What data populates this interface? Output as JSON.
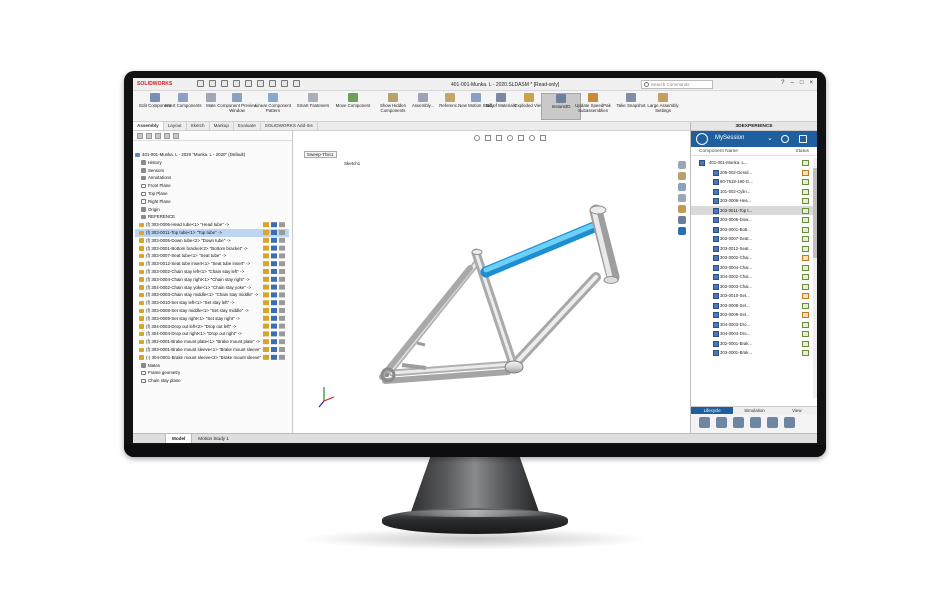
{
  "app": {
    "logo": "SOLIDWORKS",
    "document_title": "401-001-Munka. L - 2020.SLDASM * [Read-only]",
    "search_placeholder": "Search Commands"
  },
  "commands": [
    {
      "label": "Edit Component",
      "color": "#7b8fb0"
    },
    {
      "label": "Insert Components",
      "color": "#8aa0c4"
    },
    {
      "label": "Mate",
      "color": "#a0a8b8"
    },
    {
      "label": "Component Preview Window",
      "color": "#8da2c2"
    },
    {
      "label": "Linear Component Pattern",
      "color": "#8aa7cf"
    },
    {
      "label": "Smart Fasteners",
      "color": "#a8b0bc"
    },
    {
      "label": "Move Component",
      "color": "#6f9e5a"
    },
    {
      "label": "Show Hidden Components",
      "color": "#b7a36a"
    },
    {
      "label": "Assembly...",
      "color": "#9aa4b6"
    },
    {
      "label": "Referenc...",
      "color": "#c6a46a"
    },
    {
      "label": "New Motion Study",
      "color": "#8a9fc1"
    },
    {
      "label": "Bill of Materials",
      "color": "#7a8aa5"
    },
    {
      "label": "Exploded View",
      "color": "#c9a44a"
    },
    {
      "label": "Instant3D",
      "color": "#6d7f9c"
    },
    {
      "label": "Update SpeedPak Subassemblies",
      "color": "#c98a3a"
    },
    {
      "label": "Take Snapshot",
      "color": "#7f8fa8"
    },
    {
      "label": "Large Assembly Settings",
      "color": "#c2a063"
    }
  ],
  "tabs": [
    "Assembly",
    "Layout",
    "Sketch",
    "Markup",
    "Evaluate",
    "SOLIDWORKS Add-Ins"
  ],
  "tree": {
    "root": "401-001-Munka. L - 2020 \"Munka. L - 2020\" (Default)",
    "items": [
      {
        "label": "History",
        "icon": "gray"
      },
      {
        "label": "Sensors",
        "icon": "gray"
      },
      {
        "label": "Annotations",
        "icon": "gray"
      },
      {
        "label": "Front Plane",
        "icon": "none"
      },
      {
        "label": "Top Plane",
        "icon": "none"
      },
      {
        "label": "Right Plane",
        "icon": "none"
      },
      {
        "label": "Origin",
        "icon": "gray"
      },
      {
        "label": "REFERENCE",
        "icon": "gray"
      },
      {
        "label": "(f) 303-0006-Head tube<1> \"Head tube\" ->",
        "icon": "gold"
      },
      {
        "label": "(f) 303-0011-Top tube<1> \"Top tube\" ->",
        "icon": "gold",
        "highlight": true
      },
      {
        "label": "(f) 303-0005-Down tube<2> \"Down tube\" ->",
        "icon": "gold"
      },
      {
        "label": "(f) 303-0001-Bottom bracket<2> \"Bottom bracket\" ->",
        "icon": "gold"
      },
      {
        "label": "(f) 303-0007-Seat tube<1> \"Seat tube\" ->",
        "icon": "gold"
      },
      {
        "label": "(f) 303-0012-Seat tube insert<1> \"Seat tube insert\" ->",
        "icon": "gold"
      },
      {
        "label": "(f) 303-0002-Chain stay left<1> \"Chain stay left\" ->",
        "icon": "gold"
      },
      {
        "label": "(f) 303-0004-Chain stay right<1> \"Chain stay right\" ->",
        "icon": "gold"
      },
      {
        "label": "(f) 304-0002-Chain stay yoke<1> \"Chain stay yoke\" ->",
        "icon": "gold"
      },
      {
        "label": "(f) 303-0003-Chain stay middle<1> \"Chain stay middle\" ->",
        "icon": "gold"
      },
      {
        "label": "(f) 303-0010-Set stay left<1> \"Set stay left\" ->",
        "icon": "gold"
      },
      {
        "label": "(f) 303-0008-Set stay middle<1> \"Set stay middle\" ->",
        "icon": "gold"
      },
      {
        "label": "(f) 303-0009-Set stay right<1> \"Set stay right\" ->",
        "icon": "gold"
      },
      {
        "label": "(f) 304-0003-Drop out left<2> \"Drop out left\" ->",
        "icon": "gold"
      },
      {
        "label": "(f) 304-0004-Drop out right<1> \"Drop out right\" ->",
        "icon": "gold"
      },
      {
        "label": "(f) 302-0001-Brake mount plate<1> \"Brake mount plate\" ->",
        "icon": "gold"
      },
      {
        "label": "(f) 303-0001-Brake mount sleeve<1> \"Brake mount sleeve\" ->",
        "icon": "gold"
      },
      {
        "label": "(-) 304-0001-Brake mount sleeve<2> \"Brake mount sleeve\" ->",
        "icon": "gold"
      },
      {
        "label": "Mates",
        "icon": "gray"
      },
      {
        "label": "Frame geometry",
        "icon": "none"
      },
      {
        "label": "Chain stay plane",
        "icon": "none"
      }
    ]
  },
  "bottom_tabs": [
    "Model",
    "Motion Study 1"
  ],
  "graphics": {
    "sketch_chip": "Sweep-Thin1",
    "sketch_item": "Sketch1"
  },
  "experience": {
    "header": "3DEXPERIENCE",
    "session": "MySession",
    "col_name": "Component Name",
    "col_status": "Status",
    "root": "401-001-Munka. L...",
    "items": [
      {
        "name": "205-002-Derail...",
        "status": "orange"
      },
      {
        "name": "90-7518-190-G...",
        "status": "green"
      },
      {
        "name": "101-002-Cylin...",
        "status": "green"
      },
      {
        "name": "303-0006-Hea...",
        "status": "green"
      },
      {
        "name": "303-0011-Top t...",
        "status": "green",
        "selected": true
      },
      {
        "name": "303-0005-Dow...",
        "status": "green"
      },
      {
        "name": "303-0001-Bott...",
        "status": "green"
      },
      {
        "name": "303-0007-Seat...",
        "status": "green"
      },
      {
        "name": "303-0012-Seat...",
        "status": "green"
      },
      {
        "name": "303-0002-Chai...",
        "status": "orange"
      },
      {
        "name": "303-0004-Chai...",
        "status": "green"
      },
      {
        "name": "304-0002-Chai...",
        "status": "green"
      },
      {
        "name": "303-0003-Chai...",
        "status": "green"
      },
      {
        "name": "303-0010-Set...",
        "status": "orange"
      },
      {
        "name": "303-0008-Set...",
        "status": "green"
      },
      {
        "name": "303-0009-Set...",
        "status": "orange"
      },
      {
        "name": "304-0003-Dro...",
        "status": "green"
      },
      {
        "name": "304-0004-Dro...",
        "status": "green"
      },
      {
        "name": "302-0001-Brak...",
        "status": "green"
      },
      {
        "name": "303-0001-Brak...",
        "status": "green"
      }
    ],
    "footer_tabs": [
      "Lifecycle",
      "Simulation",
      "View"
    ]
  },
  "colors": {
    "accent": "#1f5f9f",
    "highlight_tube": "#3bb3ea",
    "frame": "#d9d9d9"
  }
}
